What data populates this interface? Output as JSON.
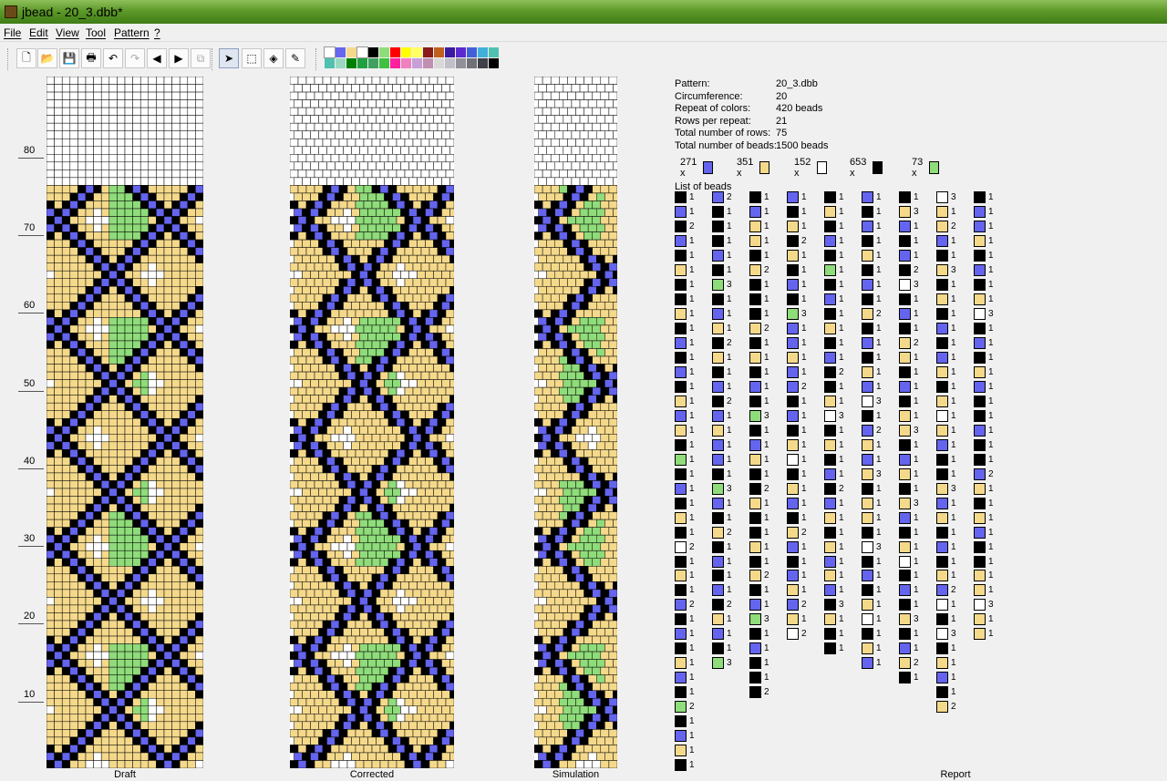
{
  "window": {
    "title": "jbead - 20_3.dbb*"
  },
  "menu": [
    "File",
    "Edit",
    "View",
    "Tool",
    "Pattern",
    "?"
  ],
  "toolbar": {
    "buttons": [
      {
        "name": "new-file-button",
        "glyph": "🗋"
      },
      {
        "name": "open-file-button",
        "glyph": "📂"
      },
      {
        "name": "save-button",
        "glyph": "💾"
      },
      {
        "name": "print-button",
        "glyph": "🖶"
      },
      {
        "name": "undo-button",
        "glyph": "↶"
      },
      {
        "name": "redo-button",
        "glyph": "↷"
      },
      {
        "name": "shift-left-button",
        "glyph": "◀"
      },
      {
        "name": "shift-right-button",
        "glyph": "▶"
      },
      {
        "name": "copy-button",
        "glyph": "⧉"
      },
      {
        "name": "select-tool-button",
        "glyph": "➤"
      },
      {
        "name": "rect-select-button",
        "glyph": "⬚"
      },
      {
        "name": "fill-tool-button",
        "glyph": "◈"
      },
      {
        "name": "pick-color-button",
        "glyph": "✎"
      }
    ],
    "palette_row1": [
      "#ffffff",
      "#6666ee",
      "#f5d98b",
      "#ffffff",
      "#000000",
      "#8fdc7a",
      "#ff0000",
      "#ffff00",
      "#ffff66",
      "#8b1a1a",
      "#c06020",
      "#3a1aa0",
      "#5a2ad0",
      "#4060d8",
      "#40b0d8",
      "#50c0b0"
    ],
    "palette_row2": [
      "#50c0b0",
      "#9ad8c0",
      "#008000",
      "#20a040",
      "#40a060",
      "#40c040",
      "#ff20a0",
      "#f080c0",
      "#c8a0d8",
      "#c090b0",
      "#d8d8d8",
      "#c0c0c8",
      "#909098",
      "#707078",
      "#404048",
      "#000000"
    ]
  },
  "colors": {
    "blue": "#6464ee",
    "yellow": "#f5d98b",
    "white": "#ffffff",
    "black": "#000000",
    "green": "#8fdc7a"
  },
  "ruler_labels": [
    "80",
    "70",
    "60",
    "50",
    "40",
    "30",
    "20",
    "10"
  ],
  "panels": {
    "draft": "Draft",
    "corrected": "Corrected",
    "simulation": "Simulation",
    "report": "Report"
  },
  "report": {
    "rows": [
      {
        "key": "Pattern:",
        "value": "20_3.dbb"
      },
      {
        "key": "Circumference:",
        "value": "20"
      },
      {
        "key": "Repeat of colors:",
        "value": "420 beads"
      },
      {
        "key": "Rows per repeat:",
        "value": "21"
      },
      {
        "key": "Total number of rows:",
        "value": "75"
      },
      {
        "key": "Total number of beads:",
        "value": "1500 beads"
      }
    ],
    "color_counts": [
      {
        "count": "271 x",
        "color": "blue"
      },
      {
        "count": "351 x",
        "color": "yellow"
      },
      {
        "count": "152 x",
        "color": "white"
      },
      {
        "count": "653 x",
        "color": "black"
      },
      {
        "count": "73 x",
        "color": "green"
      }
    ],
    "list_title": "List of beads",
    "bead_list": [
      [
        [
          "k",
          1
        ],
        [
          "b",
          1
        ],
        [
          "k",
          2
        ],
        [
          "b",
          1
        ],
        [
          "k",
          1
        ],
        [
          "y",
          1
        ],
        [
          "k",
          1
        ],
        [
          "k",
          1
        ],
        [
          "y",
          1
        ],
        [
          "k",
          1
        ],
        [
          "b",
          1
        ],
        [
          "k",
          1
        ],
        [
          "b",
          1
        ],
        [
          "k",
          1
        ],
        [
          "y",
          1
        ],
        [
          "b",
          1
        ],
        [
          "y",
          1
        ],
        [
          "k",
          1
        ],
        [
          "g",
          1
        ],
        [
          "k",
          1
        ],
        [
          "b",
          1
        ],
        [
          "k",
          1
        ],
        [
          "y",
          1
        ],
        [
          "k",
          1
        ],
        [
          "w",
          2
        ],
        [
          "k",
          1
        ],
        [
          "y",
          1
        ],
        [
          "k",
          1
        ],
        [
          "b",
          2
        ],
        [
          "k",
          1
        ],
        [
          "b",
          1
        ],
        [
          "k",
          1
        ],
        [
          "y",
          1
        ],
        [
          "b",
          1
        ],
        [
          "k",
          1
        ],
        [
          "g",
          2
        ],
        [
          "k",
          1
        ],
        [
          "b",
          1
        ],
        [
          "y",
          1
        ],
        [
          "k",
          1
        ],
        [
          "w",
          1
        ],
        [
          "y",
          1
        ],
        [
          "k",
          1
        ],
        [
          "y",
          1
        ],
        [
          "k",
          1
        ],
        [
          "b",
          1
        ],
        [
          "k",
          1
        ]
      ],
      [
        [
          "b",
          2
        ],
        [
          "k",
          1
        ],
        [
          "k",
          1
        ],
        [
          "k",
          1
        ],
        [
          "b",
          1
        ],
        [
          "k",
          1
        ],
        [
          "g",
          3
        ],
        [
          "k",
          1
        ],
        [
          "b",
          1
        ],
        [
          "y",
          1
        ],
        [
          "k",
          2
        ],
        [
          "y",
          1
        ],
        [
          "k",
          1
        ],
        [
          "b",
          1
        ],
        [
          "k",
          2
        ],
        [
          "b",
          1
        ],
        [
          "y",
          1
        ],
        [
          "b",
          1
        ],
        [
          "b",
          1
        ],
        [
          "k",
          1
        ],
        [
          "g",
          3
        ],
        [
          "b",
          1
        ],
        [
          "k",
          1
        ],
        [
          "y",
          2
        ],
        [
          "k",
          1
        ],
        [
          "b",
          1
        ],
        [
          "k",
          1
        ],
        [
          "b",
          1
        ],
        [
          "k",
          2
        ],
        [
          "y",
          1
        ],
        [
          "b",
          1
        ],
        [
          "k",
          1
        ],
        [
          "g",
          3
        ]
      ],
      [
        [
          "k",
          1
        ],
        [
          "b",
          1
        ],
        [
          "y",
          1
        ],
        [
          "y",
          1
        ],
        [
          "k",
          1
        ],
        [
          "y",
          2
        ],
        [
          "k",
          1
        ],
        [
          "k",
          1
        ],
        [
          "k",
          1
        ],
        [
          "y",
          2
        ],
        [
          "k",
          1
        ],
        [
          "y",
          1
        ],
        [
          "k",
          1
        ],
        [
          "b",
          1
        ],
        [
          "k",
          1
        ],
        [
          "g",
          3
        ],
        [
          "k",
          1
        ],
        [
          "b",
          1
        ],
        [
          "y",
          1
        ],
        [
          "k",
          1
        ],
        [
          "k",
          2
        ],
        [
          "y",
          1
        ],
        [
          "k",
          1
        ],
        [
          "k",
          1
        ],
        [
          "y",
          1
        ],
        [
          "k",
          1
        ],
        [
          "y",
          2
        ],
        [
          "k",
          1
        ],
        [
          "b",
          1
        ],
        [
          "g",
          3
        ],
        [
          "k",
          1
        ],
        [
          "b",
          1
        ],
        [
          "k",
          1
        ],
        [
          "k",
          1
        ],
        [
          "k",
          2
        ]
      ],
      [
        [
          "b",
          1
        ],
        [
          "k",
          1
        ],
        [
          "y",
          1
        ],
        [
          "k",
          2
        ],
        [
          "y",
          1
        ],
        [
          "k",
          1
        ],
        [
          "b",
          1
        ],
        [
          "k",
          1
        ],
        [
          "g",
          3
        ],
        [
          "b",
          1
        ],
        [
          "b",
          1
        ],
        [
          "y",
          1
        ],
        [
          "b",
          1
        ],
        [
          "b",
          2
        ],
        [
          "k",
          1
        ],
        [
          "b",
          1
        ],
        [
          "k",
          1
        ],
        [
          "y",
          1
        ],
        [
          "w",
          1
        ],
        [
          "k",
          1
        ],
        [
          "y",
          1
        ],
        [
          "b",
          1
        ],
        [
          "k",
          1
        ],
        [
          "y",
          2
        ],
        [
          "b",
          1
        ],
        [
          "k",
          1
        ],
        [
          "b",
          1
        ],
        [
          "y",
          1
        ],
        [
          "b",
          2
        ],
        [
          "y",
          1
        ],
        [
          "w",
          2
        ]
      ],
      [
        [
          "k",
          1
        ],
        [
          "y",
          1
        ],
        [
          "k",
          1
        ],
        [
          "b",
          1
        ],
        [
          "k",
          1
        ],
        [
          "g",
          1
        ],
        [
          "k",
          1
        ],
        [
          "b",
          1
        ],
        [
          "k",
          1
        ],
        [
          "y",
          1
        ],
        [
          "k",
          1
        ],
        [
          "b",
          1
        ],
        [
          "k",
          2
        ],
        [
          "k",
          1
        ],
        [
          "y",
          1
        ],
        [
          "w",
          3
        ],
        [
          "k",
          1
        ],
        [
          "y",
          1
        ],
        [
          "k",
          1
        ],
        [
          "b",
          1
        ],
        [
          "k",
          2
        ],
        [
          "b",
          1
        ],
        [
          "y",
          1
        ],
        [
          "k",
          1
        ],
        [
          "y",
          1
        ],
        [
          "b",
          1
        ],
        [
          "y",
          1
        ],
        [
          "b",
          1
        ],
        [
          "k",
          3
        ],
        [
          "y",
          1
        ],
        [
          "k",
          1
        ],
        [
          "k",
          1
        ]
      ],
      [
        [
          "b",
          1
        ],
        [
          "k",
          1
        ],
        [
          "b",
          1
        ],
        [
          "k",
          1
        ],
        [
          "y",
          1
        ],
        [
          "k",
          1
        ],
        [
          "b",
          1
        ],
        [
          "k",
          1
        ],
        [
          "y",
          2
        ],
        [
          "k",
          1
        ],
        [
          "b",
          1
        ],
        [
          "k",
          1
        ],
        [
          "y",
          1
        ],
        [
          "b",
          1
        ],
        [
          "w",
          3
        ],
        [
          "k",
          1
        ],
        [
          "b",
          2
        ],
        [
          "y",
          1
        ],
        [
          "b",
          1
        ],
        [
          "y",
          3
        ],
        [
          "k",
          1
        ],
        [
          "y",
          1
        ],
        [
          "y",
          1
        ],
        [
          "k",
          1
        ],
        [
          "w",
          3
        ],
        [
          "k",
          1
        ],
        [
          "b",
          1
        ],
        [
          "k",
          1
        ],
        [
          "y",
          1
        ],
        [
          "w",
          1
        ],
        [
          "k",
          1
        ],
        [
          "y",
          1
        ],
        [
          "b",
          1
        ]
      ],
      [
        [
          "k",
          1
        ],
        [
          "y",
          3
        ],
        [
          "b",
          1
        ],
        [
          "k",
          1
        ],
        [
          "b",
          1
        ],
        [
          "k",
          2
        ],
        [
          "w",
          3
        ],
        [
          "k",
          1
        ],
        [
          "b",
          1
        ],
        [
          "k",
          1
        ],
        [
          "y",
          2
        ],
        [
          "y",
          1
        ],
        [
          "k",
          1
        ],
        [
          "b",
          1
        ],
        [
          "k",
          1
        ],
        [
          "y",
          1
        ],
        [
          "y",
          3
        ],
        [
          "k",
          1
        ],
        [
          "b",
          1
        ],
        [
          "y",
          1
        ],
        [
          "k",
          1
        ],
        [
          "y",
          3
        ],
        [
          "b",
          1
        ],
        [
          "k",
          1
        ],
        [
          "y",
          1
        ],
        [
          "w",
          1
        ],
        [
          "k",
          1
        ],
        [
          "b",
          1
        ],
        [
          "k",
          1
        ],
        [
          "y",
          3
        ],
        [
          "k",
          1
        ],
        [
          "b",
          1
        ],
        [
          "y",
          2
        ],
        [
          "k",
          1
        ]
      ],
      [
        [
          "w",
          3
        ],
        [
          "y",
          1
        ],
        [
          "y",
          2
        ],
        [
          "b",
          1
        ],
        [
          "k",
          1
        ],
        [
          "y",
          3
        ],
        [
          "k",
          1
        ],
        [
          "y",
          1
        ],
        [
          "k",
          1
        ],
        [
          "b",
          1
        ],
        [
          "k",
          1
        ],
        [
          "b",
          1
        ],
        [
          "y",
          1
        ],
        [
          "k",
          1
        ],
        [
          "y",
          1
        ],
        [
          "w",
          1
        ],
        [
          "y",
          1
        ],
        [
          "b",
          1
        ],
        [
          "k",
          1
        ],
        [
          "k",
          1
        ],
        [
          "y",
          3
        ],
        [
          "b",
          1
        ],
        [
          "y",
          1
        ],
        [
          "k",
          1
        ],
        [
          "b",
          1
        ],
        [
          "k",
          1
        ],
        [
          "y",
          1
        ],
        [
          "b",
          2
        ],
        [
          "w",
          1
        ],
        [
          "k",
          1
        ],
        [
          "w",
          3
        ],
        [
          "k",
          1
        ],
        [
          "y",
          1
        ],
        [
          "b",
          1
        ],
        [
          "k",
          1
        ],
        [
          "y",
          2
        ]
      ],
      [
        [
          "k",
          1
        ],
        [
          "b",
          1
        ],
        [
          "b",
          1
        ],
        [
          "y",
          1
        ],
        [
          "k",
          1
        ],
        [
          "b",
          1
        ],
        [
          "k",
          1
        ],
        [
          "y",
          1
        ],
        [
          "w",
          3
        ],
        [
          "k",
          1
        ],
        [
          "b",
          1
        ],
        [
          "k",
          1
        ],
        [
          "y",
          1
        ],
        [
          "b",
          1
        ],
        [
          "k",
          1
        ],
        [
          "k",
          1
        ],
        [
          "b",
          1
        ],
        [
          "k",
          1
        ],
        [
          "k",
          1
        ],
        [
          "b",
          2
        ],
        [
          "y",
          1
        ],
        [
          "k",
          1
        ],
        [
          "y",
          1
        ],
        [
          "b",
          1
        ],
        [
          "k",
          1
        ],
        [
          "k",
          1
        ],
        [
          "y",
          1
        ],
        [
          "y",
          1
        ],
        [
          "w",
          3
        ],
        [
          "y",
          1
        ],
        [
          "y",
          1
        ]
      ]
    ]
  },
  "pattern": {
    "cols": 20,
    "rows": 75,
    "empty_rows": 14
  }
}
